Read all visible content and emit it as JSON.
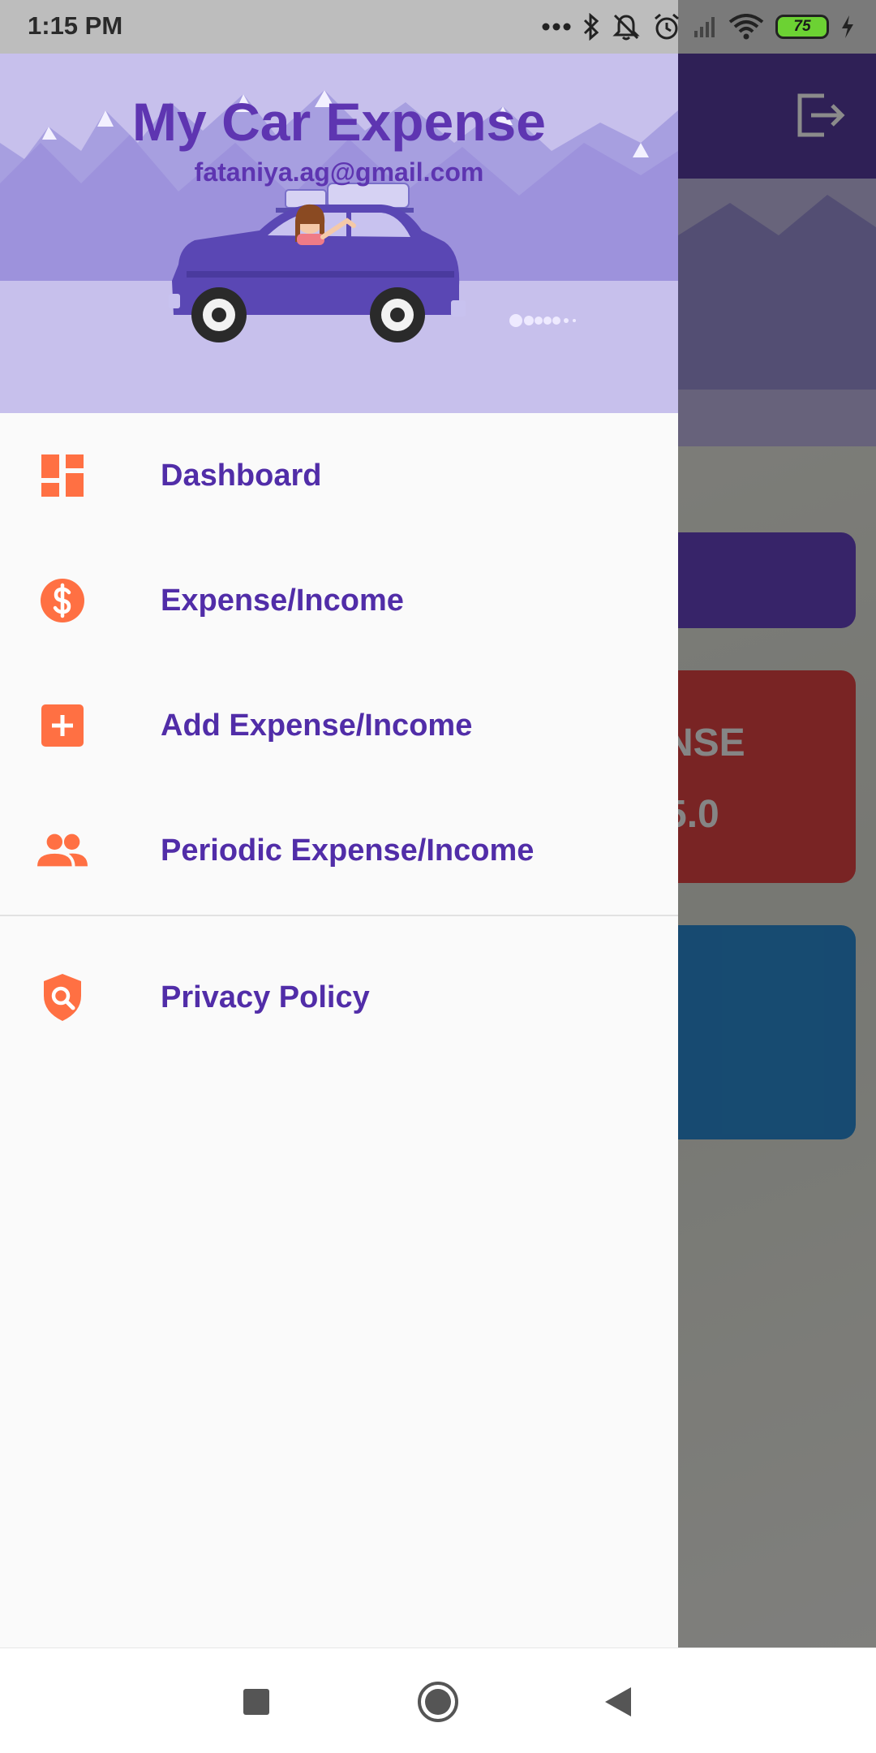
{
  "status_bar": {
    "time": "1:15 PM",
    "battery_level": "75"
  },
  "drawer": {
    "app_title": "My Car Expense",
    "user_email": "fataniya.ag@gmail.com",
    "menu": [
      {
        "label": "Dashboard",
        "icon": "dashboard-icon"
      },
      {
        "label": "Expense/Income",
        "icon": "dollar-icon"
      },
      {
        "label": "Add Expense/Income",
        "icon": "add-box-icon"
      },
      {
        "label": "Periodic Expense/Income",
        "icon": "people-icon"
      }
    ],
    "secondary_menu": [
      {
        "label": "Privacy Policy",
        "icon": "shield-search-icon"
      }
    ]
  },
  "background": {
    "expense_card_partial_title": "NSE",
    "expense_card_partial_value": "5.0"
  },
  "colors": {
    "accent": "#5e35b1",
    "icon_orange": "#ff7043",
    "header_bg": "#c7c0ec"
  }
}
